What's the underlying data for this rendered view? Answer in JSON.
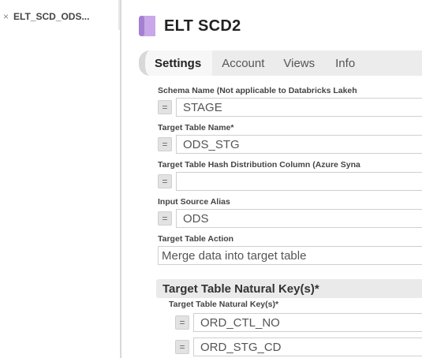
{
  "left_tab": {
    "close_glyph": "×",
    "label": "ELT_SCD_ODS..."
  },
  "header": {
    "title": "ELT SCD2",
    "icon": "snap-icon",
    "icon_color": "#c8a8e8"
  },
  "tabs": [
    {
      "label": "Settings",
      "active": true
    },
    {
      "label": "Account",
      "active": false
    },
    {
      "label": "Views",
      "active": false
    },
    {
      "label": "Info",
      "active": false
    }
  ],
  "fields": {
    "schema": {
      "label": "Schema Name (Not applicable to Databricks Lakeh",
      "value": "STAGE",
      "button": "="
    },
    "target_table": {
      "label": "Target Table Name*",
      "value": "ODS_STG",
      "button": "="
    },
    "hash_column": {
      "label": "Target Table Hash Distribution Column (Azure Syna",
      "value": "",
      "button": "="
    },
    "input_alias": {
      "label": "Input Source Alias",
      "value": "ODS",
      "button": "="
    },
    "table_action": {
      "label": "Target Table Action",
      "value": "Merge data into target table"
    }
  },
  "natural_keys": {
    "section_title": "Target Table Natural Key(s)*",
    "sub_label": "Target Table Natural Key(s)*",
    "items": [
      {
        "button": "=",
        "value": "ORD_CTL_NO"
      },
      {
        "button": "=",
        "value": "ORD_STG_CD"
      }
    ]
  }
}
